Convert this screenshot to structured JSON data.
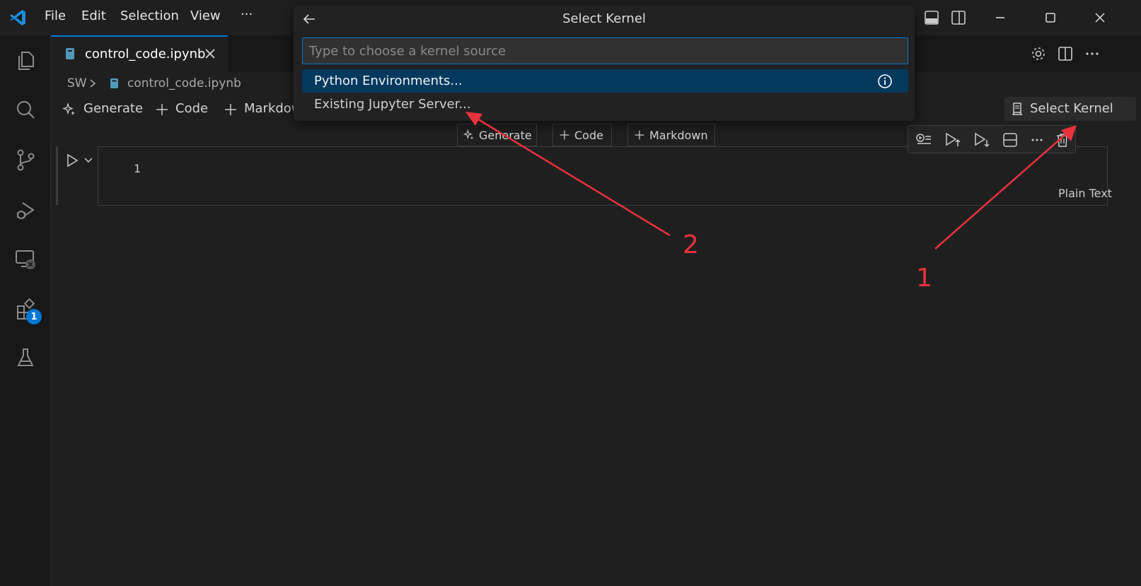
{
  "titlebar": {
    "menus": [
      "File",
      "Edit",
      "Selection",
      "View",
      "···"
    ]
  },
  "activitybar": {
    "icons": [
      "explorer-icon",
      "search-icon",
      "source-control-icon",
      "run-debug-icon",
      "remote-explorer-icon",
      "extensions-icon",
      "testing-icon"
    ],
    "extensions_badge": "1"
  },
  "tab": {
    "filename": "control_code.ipynb"
  },
  "breadcrumb": {
    "folder": "SW",
    "file": "control_code.ipynb"
  },
  "notebook_toolbar": {
    "generate": "Generate",
    "code": "Code",
    "markdown": "Markdow",
    "select_kernel": "Select Kernel"
  },
  "insert_bar": {
    "generate": "Generate",
    "code": "Code",
    "markdown": "Markdown"
  },
  "cell": {
    "line_number": "1",
    "language": "Plain Text"
  },
  "quickpick": {
    "title": "Select Kernel",
    "placeholder": "Type to choose a kernel source",
    "items": [
      "Python Environments...",
      "Existing Jupyter Server..."
    ]
  },
  "annotations": {
    "label_1": "1",
    "label_2": "2",
    "color": "#e8323c"
  },
  "colors": {
    "accent": "#0078d4",
    "selected_item": "#04395e"
  }
}
